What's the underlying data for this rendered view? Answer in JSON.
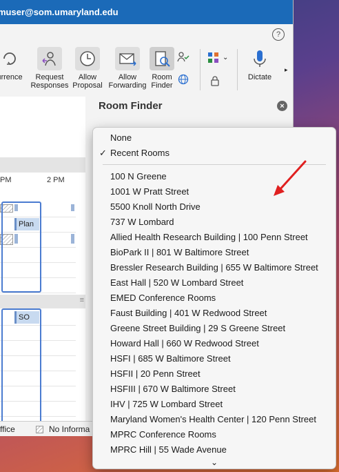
{
  "titlebar": {
    "account": "muser@som.umaryland.edu"
  },
  "ribbon": {
    "help": "?",
    "buttons": [
      {
        "label": "urrence",
        "icon": "recurrence-icon"
      },
      {
        "label": "Request\nResponses",
        "icon": "request-responses-icon"
      },
      {
        "label": "Allow\nProposal",
        "icon": "clock-icon"
      },
      {
        "label": "Allow\nForwarding",
        "icon": "envelope-icon"
      },
      {
        "label": "Room\nFinder",
        "icon": "room-finder-icon"
      },
      {
        "label": "Dictate",
        "icon": "microphone-icon"
      }
    ]
  },
  "schedule": {
    "time_left": "PM",
    "time_right": "2 PM",
    "chip1": "Plan",
    "chip2": "SO"
  },
  "status": {
    "office": "ffice",
    "no_info": "No Informa"
  },
  "room_finder": {
    "title": "Room Finder",
    "close": "×"
  },
  "dropdown": {
    "top_items": [
      {
        "label": "None",
        "checked": false
      },
      {
        "label": "Recent Rooms",
        "checked": true
      }
    ],
    "check_glyph": "✓",
    "rooms": [
      "100 N Greene",
      "1001 W Pratt Street",
      "5500 Knoll North Drive",
      "737 W Lombard",
      "Allied Health Research Building | 100 Penn Street",
      "BioPark II | 801 W Baltimore Street",
      "Bressler Research Building | 655 W Baltimore Street",
      "East Hall | 520 W Lombard Street",
      "EMED Conference Rooms",
      "Faust Building | 401 W Redwood Street",
      "Greene Street Building | 29 S Greene Street",
      "Howard Hall | 660 W Redwood Street",
      "HSFI | 685 W Baltimore Street",
      "HSFII | 20 Penn Street",
      "HSFIII | 670 W Baltimore Street",
      "IHV | 725 W Lombard Street",
      "Maryland Women's Health Center | 120 Penn Street",
      "MPRC Conference Rooms",
      "MPRC Hill | 55 Wade Avenue"
    ],
    "more_glyph": "⌄"
  },
  "colors": {
    "titlebar": "#1b6ab8",
    "annotation_arrow": "#e02020"
  }
}
